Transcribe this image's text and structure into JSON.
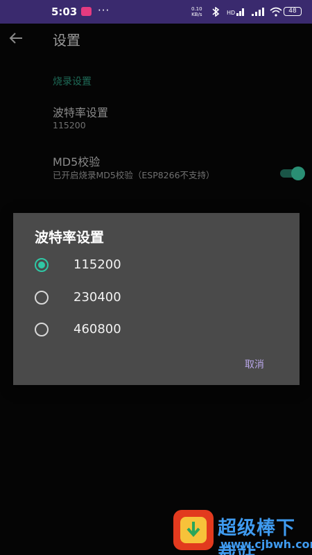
{
  "status_bar": {
    "time": "5:03",
    "more": "···",
    "net_speed_value": "0.10",
    "net_speed_unit": "KB/s",
    "battery": "48"
  },
  "app_bar": {
    "title": "设置"
  },
  "settings": {
    "section_header": "烧录设置",
    "baud": {
      "title": "波特率设置",
      "summary": "115200"
    },
    "md5": {
      "title": "MD5校验",
      "summary": "已开启烧录MD5校验（ESP8266不支持）",
      "enabled": true
    }
  },
  "dialog": {
    "title": "波特率设置",
    "options": [
      {
        "label": "115200",
        "selected": true
      },
      {
        "label": "230400",
        "selected": false
      },
      {
        "label": "460800",
        "selected": false
      }
    ],
    "cancel_label": "取消"
  },
  "watermark": {
    "brand": "超级棒下载站",
    "url": "www.cjbwh.com"
  },
  "colors": {
    "accent": "#2fc8a5",
    "dialog_bg": "#4a4a4a",
    "cancel": "#b8a6e8",
    "status_bar": "#3a2a6e"
  }
}
